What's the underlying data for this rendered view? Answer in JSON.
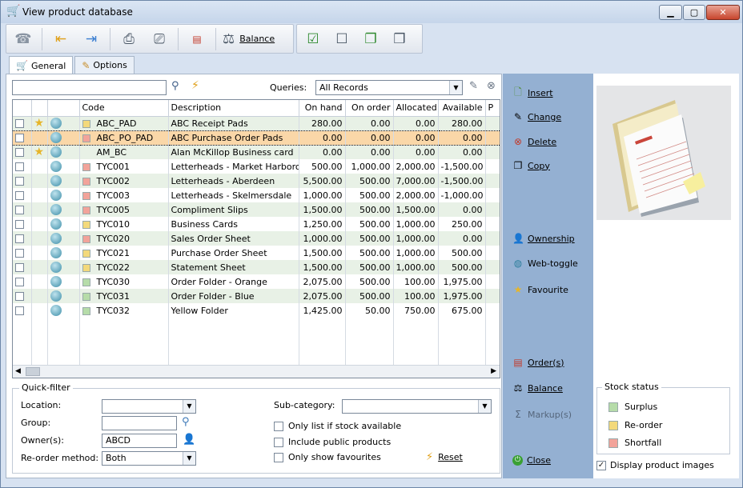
{
  "window": {
    "title": "View product database",
    "controls": {
      "minimize": "▁",
      "maximize": "▢",
      "close": "✕"
    }
  },
  "toolbar": {
    "balance_label": "Balance"
  },
  "tabs": [
    {
      "label": "General",
      "icon": "cart-icon"
    },
    {
      "label": "Options",
      "icon": "options-icon"
    }
  ],
  "search": {
    "value": ""
  },
  "queries": {
    "label": "Queries:",
    "selected": "All Records"
  },
  "grid": {
    "columns": [
      "",
      "",
      "",
      "Code",
      "Description",
      "On hand",
      "On order",
      "Allocated",
      "Available",
      "P"
    ],
    "rows": [
      {
        "checked": false,
        "fav": true,
        "status": "reorder",
        "code": "ABC_PAD",
        "description": "ABC Receipt Pads",
        "on_hand": "280.00",
        "on_order": "0.00",
        "allocated": "0.00",
        "available": "280.00"
      },
      {
        "checked": false,
        "fav": false,
        "status": "shortfall",
        "code": "ABC_PO_PAD",
        "description": "ABC  Purchase Order Pads",
        "on_hand": "0.00",
        "on_order": "0.00",
        "allocated": "0.00",
        "available": "0.00"
      },
      {
        "checked": false,
        "fav": true,
        "status": "none",
        "code": "AM_BC",
        "description": "Alan McKillop Business card",
        "on_hand": "0.00",
        "on_order": "0.00",
        "allocated": "0.00",
        "available": "0.00"
      },
      {
        "checked": false,
        "fav": false,
        "status": "shortfall",
        "code": "TYC001",
        "description": "Letterheads - Market Harborough",
        "on_hand": "500.00",
        "on_order": "1,000.00",
        "allocated": "2,000.00",
        "available": "-1,500.00"
      },
      {
        "checked": false,
        "fav": false,
        "status": "shortfall",
        "code": "TYC002",
        "description": "Letterheads - Aberdeen",
        "on_hand": "5,500.00",
        "on_order": "500.00",
        "allocated": "7,000.00",
        "available": "-1,500.00"
      },
      {
        "checked": false,
        "fav": false,
        "status": "shortfall",
        "code": "TYC003",
        "description": "Letterheads - Skelmersdale",
        "on_hand": "1,000.00",
        "on_order": "500.00",
        "allocated": "2,000.00",
        "available": "-1,000.00"
      },
      {
        "checked": false,
        "fav": false,
        "status": "shortfall",
        "code": "TYC005",
        "description": "Compliment Slips",
        "on_hand": "1,500.00",
        "on_order": "500.00",
        "allocated": "1,500.00",
        "available": "0.00"
      },
      {
        "checked": false,
        "fav": false,
        "status": "reorder",
        "code": "TYC010",
        "description": "Business Cards",
        "on_hand": "1,250.00",
        "on_order": "500.00",
        "allocated": "1,000.00",
        "available": "250.00"
      },
      {
        "checked": false,
        "fav": false,
        "status": "shortfall",
        "code": "TYC020",
        "description": "Sales Order Sheet",
        "on_hand": "1,000.00",
        "on_order": "500.00",
        "allocated": "1,000.00",
        "available": "0.00"
      },
      {
        "checked": false,
        "fav": false,
        "status": "reorder",
        "code": "TYC021",
        "description": "Purchase Order Sheet",
        "on_hand": "1,500.00",
        "on_order": "500.00",
        "allocated": "1,000.00",
        "available": "500.00"
      },
      {
        "checked": false,
        "fav": false,
        "status": "reorder",
        "code": "TYC022",
        "description": "Statement Sheet",
        "on_hand": "1,500.00",
        "on_order": "500.00",
        "allocated": "1,000.00",
        "available": "500.00"
      },
      {
        "checked": false,
        "fav": false,
        "status": "surplus",
        "code": "TYC030",
        "description": "Order Folder - Orange",
        "on_hand": "2,075.00",
        "on_order": "500.00",
        "allocated": "100.00",
        "available": "1,975.00"
      },
      {
        "checked": false,
        "fav": false,
        "status": "surplus",
        "code": "TYC031",
        "description": "Order Folder - Blue",
        "on_hand": "2,075.00",
        "on_order": "500.00",
        "allocated": "100.00",
        "available": "1,975.00"
      },
      {
        "checked": false,
        "fav": false,
        "status": "surplus",
        "code": "TYC032",
        "description": "Yellow Folder",
        "on_hand": "1,425.00",
        "on_order": "50.00",
        "allocated": "750.00",
        "available": "675.00"
      }
    ]
  },
  "quick_filter": {
    "title": "Quick-filter",
    "location_label": "Location:",
    "location_value": "",
    "group_label": "Group:",
    "group_value": "",
    "owner_label": "Owner(s):",
    "owner_value": "ABCD",
    "reorder_label": "Re-order method:",
    "reorder_value": "Both",
    "subcategory_label": "Sub-category:",
    "subcategory_value": "",
    "only_stock_label": "Only list if stock available",
    "include_public_label": "Include public products",
    "only_favourites_label": "Only show favourites",
    "reset_label": "Reset"
  },
  "side": {
    "insert": "Insert",
    "change": "Change",
    "delete": "Delete",
    "copy": "Copy",
    "ownership": "Ownership",
    "web_toggle": "Web-toggle",
    "favourite": "Favourite",
    "orders": "Order(s)",
    "balance": "Balance",
    "markup": "Markup(s)",
    "close": "Close"
  },
  "stock_status": {
    "title": "Stock status",
    "surplus": "Surplus",
    "reorder": "Re-order",
    "shortfall": "Shortfall"
  },
  "display_images_label": "Display product images",
  "colors": {
    "surplus": "#b6dca9",
    "reorder": "#f3d97b",
    "shortfall": "#f2a39a",
    "selected_row": "#fad7a8",
    "alt_row": "#e8f1e6",
    "side_panel": "#94b0d2"
  }
}
